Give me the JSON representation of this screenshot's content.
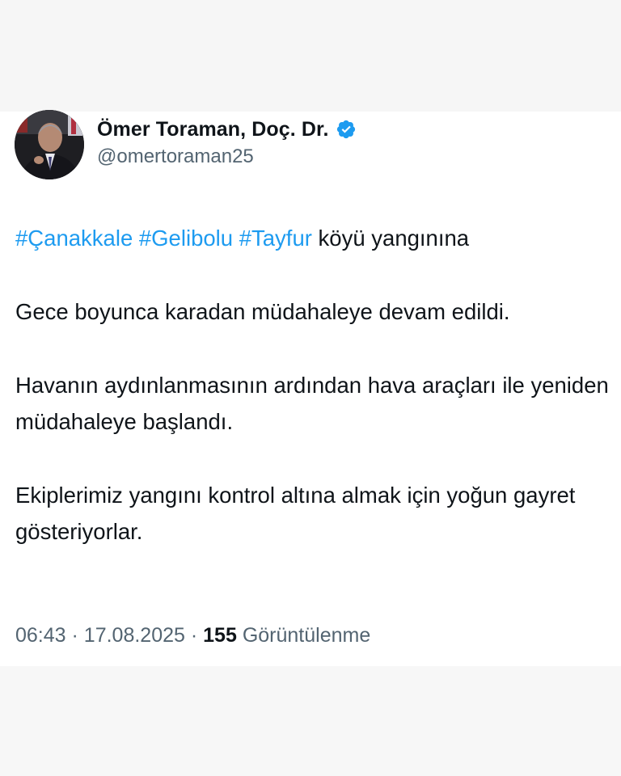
{
  "user": {
    "display_name": "Ömer Toraman, Doç. Dr.",
    "handle": "@omertoraman25",
    "verified_icon": "verified-badge-icon"
  },
  "tweet": {
    "line1": {
      "hashtags": [
        "#Çanakkale",
        "#Gelibolu",
        "#Tayfur"
      ],
      "rest": "köyü yangınına"
    },
    "para2": "Gece boyunca karadan müdahaleye devam edildi.",
    "para3": "Havanın aydınlanmasının ardından hava araçları ile yeniden müdahaleye başlandı.",
    "para4": "Ekiplerimiz yangını kontrol altına almak için yoğun gayret gösteriyorlar."
  },
  "meta": {
    "time": "06:43",
    "sep1": "·",
    "date": "17.08.2025",
    "sep2": "·",
    "views_count": "155",
    "views_label": "Görüntülenme"
  },
  "colors": {
    "hashtag": "#1d9bf0",
    "secondary_text": "#536471",
    "primary_text": "#0f1419",
    "verified": "#1d9bf0"
  }
}
